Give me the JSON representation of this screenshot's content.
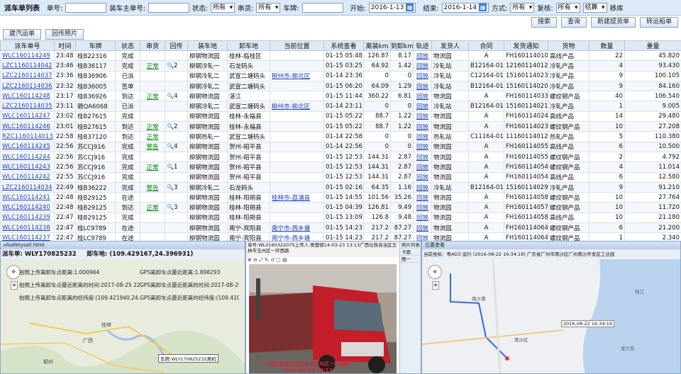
{
  "filter": {
    "title": "派车单列表",
    "order_no_label": "单号:",
    "load_order_label": "装车主单号:",
    "status_label": "状态:",
    "status_value": "所有",
    "chuanhuo_label": "串货:",
    "chuanhuo_value": "所有",
    "plate_label": "车牌:",
    "start_label": "开始:",
    "start_value": "2016-1-13",
    "end_label": "结束:",
    "end_value": "2016-1-14",
    "mode_label": "方式:",
    "mode_value": "所有",
    "recheck_label": "复核:",
    "recheck_value": "所有",
    "settle_label": "结算",
    "move_label": "移库"
  },
  "toolbar": {
    "search": "搜索",
    "query": "查询",
    "new_bill": "新建提货单",
    "transfer": "转运船单",
    "new_truck": "建汽运单",
    "return_photo": "回传照片"
  },
  "table": {
    "headers": [
      "派车单号",
      "时间",
      "车牌",
      "状态",
      "串货",
      "回传",
      "装车地",
      "卸车地",
      "当前位置",
      "系统查看",
      "离装km",
      "到卸km",
      "轨迹",
      "发货人",
      "合同",
      "发货通知",
      "货物",
      "数量",
      "重量"
    ],
    "rows": [
      [
        "WLC160114249",
        "23:48",
        "桂B22316",
        "完成",
        "",
        "",
        "柳钢物流园",
        "桂林-临桂区",
        "",
        "01-15 05:48",
        "126.87",
        "8.17",
        "回放",
        "物流园",
        "A",
        "FH1601140105",
        "高线产品",
        "22",
        "45.820"
      ],
      [
        "LZC1160114042",
        "23:46",
        "桂B36117",
        "完成",
        "正常",
        "2",
        "柳钢冷轧一",
        "石龙码头",
        "",
        "01-15 03:25",
        "64.92",
        "1.42",
        "回放",
        "冷轧站",
        "B12164-01",
        "12160114012",
        "冷轧产品",
        "4",
        "93.430"
      ],
      [
        "LZC2160114037",
        "23:36",
        "桂B36906",
        "已派",
        "",
        "",
        "柳钢冷轧二",
        "武宣二塘码头",
        "柳州市-柳北区",
        "01-14 23:36",
        "0",
        "0",
        "回放",
        "冷轧站",
        "C12164-01",
        "15160114023",
        "冷轧产品",
        "9",
        "100.105"
      ],
      [
        "LZC2160114036",
        "23:32",
        "桂B36005",
        "签单",
        "",
        "",
        "柳钢冷轧二",
        "武宣二塘码头",
        "",
        "01-15 06:20",
        "64.09",
        "1.29",
        "回放",
        "冷轧站",
        "B12164-01",
        "15160114020",
        "冷轧产品",
        "9",
        "84.160"
      ],
      [
        "WLC160114248",
        "23:17",
        "桂B36926",
        "到达",
        "正常",
        "4",
        "柳钢物流园",
        "湛江",
        "",
        "01-15 11:44",
        "360.22",
        "6.81",
        "回放",
        "物流园",
        "A",
        "FH1601140332",
        "螺纹钢产品",
        "40",
        "106.540"
      ],
      [
        "LZC2160114035",
        "23:11",
        "赣QA6068",
        "已派",
        "",
        "",
        "柳钢冷轧二",
        "武宣二塘码头",
        "柳州市-柳北区",
        "01-14 23:11",
        "0",
        "0",
        "回放",
        "冷轧站",
        "B12164-01",
        "15160114021",
        "冷轧产品",
        "1",
        "9.005"
      ],
      [
        "WLC160114247",
        "23:02",
        "桂B27615",
        "完成",
        "",
        "",
        "柳钢物流园",
        "桂林-永福县",
        "",
        "01-15 05:22",
        "88.7",
        "1.22",
        "回放",
        "物流园",
        "A",
        "FH1601140244",
        "高线产品",
        "14",
        "29.480"
      ],
      [
        "WLC160114246",
        "23:01",
        "桂B27615",
        "到达",
        "正常",
        "2",
        "柳钢物流园",
        "桂林-永福县",
        "",
        "01-15 05:22",
        "88.7",
        "1.22",
        "回放",
        "物流园",
        "A",
        "FH1601140239",
        "螺纹钢产品",
        "10",
        "27.208"
      ],
      [
        "RZC1160114013",
        "22:58",
        "桂B37120",
        "到达",
        "正常",
        "",
        "柳钢热轧一",
        "武宣二塘码头",
        "",
        "01-14 22:58",
        "0",
        "0",
        "回放",
        "热轧站",
        "C11164-01",
        "11160114012",
        "热轧产品",
        "5",
        "110.380"
      ],
      [
        "WLC160114245",
        "22:56",
        "苏CCJ916",
        "完成",
        "警告",
        "4",
        "柳钢物流园",
        "贺州-昭平县",
        "",
        "01-14 22:56",
        "0",
        "0",
        "回放",
        "物流园",
        "A",
        "FH1601140550",
        "高线产品",
        "6",
        "10.500"
      ],
      [
        "WLC160114244",
        "22:56",
        "苏CCJ916",
        "完成",
        "",
        "",
        "柳钢物流园",
        "贺州-昭平县",
        "",
        "01-15 12:53",
        "144.31",
        "2.87",
        "回放",
        "物流园",
        "A",
        "FH1601140551",
        "螺纹钢产品",
        "2",
        "4.792"
      ],
      [
        "WLC160114243",
        "22:56",
        "苏CCJ916",
        "完成",
        "正常",
        "1",
        "柳钢物流园",
        "贺州-昭平县",
        "",
        "01-15 12:53",
        "144.31",
        "2.87",
        "回放",
        "物流园",
        "A",
        "FH1601140543",
        "螺纹钢产品",
        "4",
        "11.014"
      ],
      [
        "WLC160114242",
        "22:55",
        "苏CCJ916",
        "完成",
        "",
        "",
        "柳钢物流园",
        "贺州-昭平县",
        "",
        "01-15 12:53",
        "144.31",
        "2.87",
        "回放",
        "物流园",
        "A",
        "FH1601140542",
        "高线产品",
        "6",
        "12.580"
      ],
      [
        "LZC2160114034",
        "22:49",
        "桂B36222",
        "完成",
        "警告",
        "3",
        "柳钢冷轧二",
        "石龙码头",
        "",
        "01-15 02:16",
        "64.35",
        "1.16",
        "回放",
        "冷轧站",
        "B12164-01",
        "15160114029",
        "冷轧产品",
        "9",
        "91.210"
      ],
      [
        "WLC160114241",
        "22:48",
        "桂B29125",
        "在途",
        "",
        "",
        "柳钢物流园",
        "桂林-阳朔县",
        "桂林市-荔浦县",
        "01-15 14:55",
        "101.56",
        "35.26",
        "回放",
        "物流园",
        "A",
        "FH1601140581",
        "螺纹钢产品",
        "10",
        "27.764"
      ],
      [
        "WLC160114240",
        "22:48",
        "桂B29125",
        "到达",
        "正常",
        "3",
        "柳钢物流园",
        "桂林-阳朔县",
        "",
        "01-15 04:39",
        "126.81",
        "9.49",
        "回放",
        "物流园",
        "A",
        "FH1601140578",
        "螺纹钢产品",
        "10",
        "11.720"
      ],
      [
        "WLC160114239",
        "22:47",
        "桂B29125",
        "完成",
        "",
        "",
        "柳钢物流园",
        "桂林-阳朔县",
        "",
        "01-15 13:09",
        "126.8",
        "9.48",
        "回放",
        "物流园",
        "A",
        "FH1601140580",
        "高线产品",
        "10",
        "21.180"
      ],
      [
        "WLC160114238",
        "22:47",
        "桂LC9789",
        "在途",
        "",
        "",
        "柳钢物流园",
        "南宁-宾阳县",
        "南宁市-西乡塘",
        "01-15 14:23",
        "217.2",
        "87.27",
        "回放",
        "物流园",
        "A",
        "FH1601140641",
        "螺纹钢产品",
        "6",
        "21.200"
      ],
      [
        "WLC160114237",
        "22:47",
        "桂LC9789",
        "在途",
        "",
        "",
        "柳钢物流园",
        "南宁-宾阳县",
        "南宁市-西乡塘",
        "01-15 14:23",
        "217.2",
        "87.27",
        "回放",
        "物流园",
        "A",
        "FH1601140640",
        "螺纹钢产品",
        "1",
        "2.340"
      ]
    ]
  },
  "map1": {
    "tab": "vlsafetysail.html",
    "header_left": "派车单: WLY170825232",
    "header_right": "卸车地: (109.429167,24.396931)",
    "info": [
      [
        "拍照上传离卸车点距离:1.000964",
        "GPS离卸车点最近距离:1.898293"
      ],
      [
        "拍照上传离卸车点最近距离的时间:2017-08-25 22:46:54",
        "GPS离卸车点最近距离的时间:2017-08-25 2"
      ],
      [
        "拍照上传离卸车点距离的经纬度:(109.421940,24.398058)",
        "GPS离卸车点最近距离的经纬度:(109.41040"
      ]
    ],
    "places": [
      "桂林",
      "广西",
      "柳州"
    ],
    "marker": "车牌:WLY170825232离机"
  },
  "photo": {
    "caption": "单号:WL016032207S上传人:吴楚德14-03-23 13:13广西壮族自治区玉林市玉州区一环西路",
    "tools": "⊕ ⊖ ⤢ ↻ ↺ ▢ ▤",
    "side_items": [
      "照片列表",
      "卡面",
      "图一"
    ],
    "stamp1": "广西壮族自治区玉林市玉州区一环西路",
    "stamp2": "2016-03-23 13:13"
  },
  "map2": {
    "tab": "位置查看",
    "header": "当前坐标：粤AD3 运行 (2016-08-22 16:34:19) 广东省广州市南沙区广州南沙开发区工业园",
    "stamp": "2016-08-22 16:34:19",
    "places": [
      "南沙港",
      "南沙区",
      "龙穴岛",
      "珠江"
    ]
  }
}
